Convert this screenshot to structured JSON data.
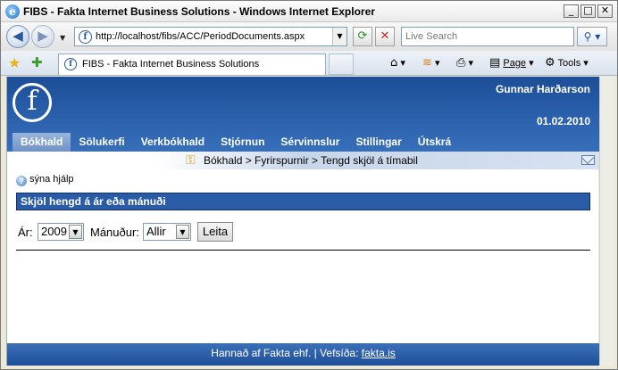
{
  "window": {
    "title": "FIBS - Fakta Internet Business Solutions - Windows Internet Explorer",
    "minimize": "_",
    "maximize": "□",
    "close": "✕"
  },
  "addressbar": {
    "url": "http://localhost/fibs/ACC/PeriodDocuments.aspx",
    "search_placeholder": "Live Search"
  },
  "tabs": {
    "active_tab": "FIBS - Fakta Internet Business Solutions",
    "commands": {
      "page": "Page",
      "tools": "Tools"
    }
  },
  "app": {
    "logo_letter": "f",
    "user": "Gunnar Harðarson",
    "date": "01.02.2010",
    "menu": [
      "Bókhald",
      "Sölukerfi",
      "Verkbókhald",
      "Stjórnun",
      "Sérvinnslur",
      "Stillingar",
      "Útskrá"
    ],
    "active_menu": "Bókhald",
    "breadcrumb": "Bókhald > Fyrirspurnir > Tengd skjöl á tímabil",
    "help_link": "sýna hjálp",
    "section_title": "Skjöl hengd á ár eða mánuði",
    "filters": {
      "year_label": "Ár:",
      "year_value": "2009",
      "month_label": "Mánuður:",
      "month_value": "Allir",
      "search_button": "Leita"
    },
    "footer": {
      "text": "Hannað af Fakta ehf. | Vefsíða:",
      "link": "fakta.is"
    }
  },
  "icons": [
    "ie-logo-icon",
    "back-icon",
    "forward-icon",
    "refresh-icon",
    "stop-icon",
    "search-icon",
    "favorites-star-icon",
    "add-favorites-icon",
    "home-icon",
    "feeds-icon",
    "print-icon",
    "page-icon",
    "tools-gear-icon",
    "key-icon",
    "mail-icon",
    "help-icon"
  ],
  "colors": {
    "header_blue": "#2c62ae",
    "section_bar": "#2a5ba6",
    "active_menu": "#7f9fce"
  }
}
